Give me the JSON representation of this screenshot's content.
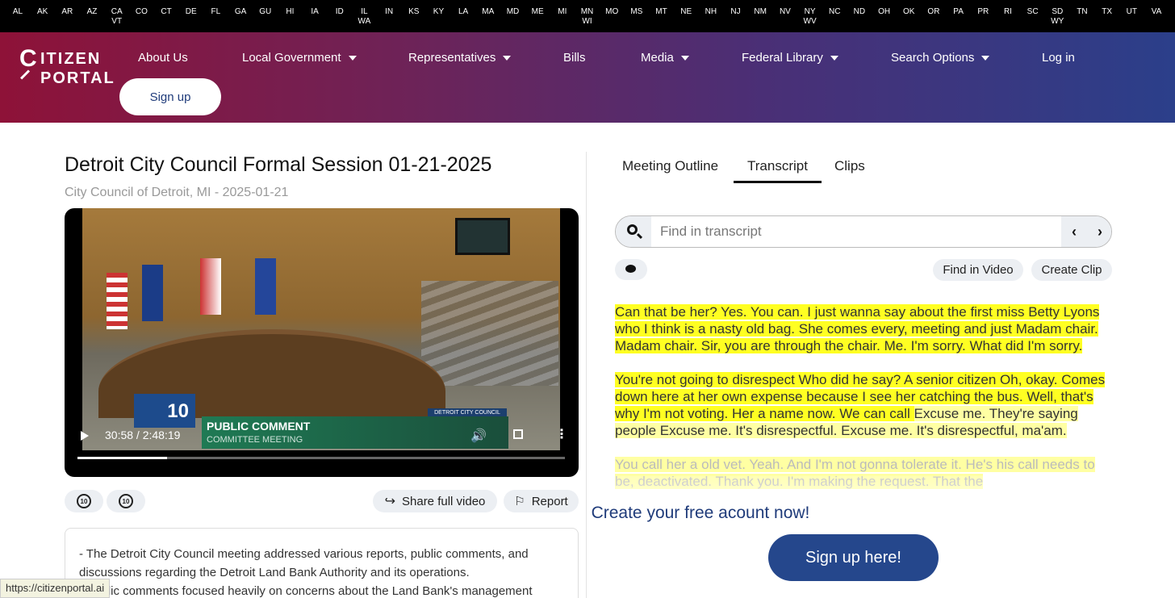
{
  "states": [
    {
      "a": "AL"
    },
    {
      "a": "AK"
    },
    {
      "a": "AR"
    },
    {
      "a": "AZ"
    },
    {
      "a": "CA",
      "b": "VT"
    },
    {
      "a": "CO"
    },
    {
      "a": "CT"
    },
    {
      "a": "DE"
    },
    {
      "a": "FL"
    },
    {
      "a": "GA"
    },
    {
      "a": "GU"
    },
    {
      "a": "HI"
    },
    {
      "a": "IA"
    },
    {
      "a": "ID"
    },
    {
      "a": "IL",
      "b": "WA"
    },
    {
      "a": "IN"
    },
    {
      "a": "KS"
    },
    {
      "a": "KY"
    },
    {
      "a": "LA"
    },
    {
      "a": "MA"
    },
    {
      "a": "MD"
    },
    {
      "a": "ME"
    },
    {
      "a": "MI"
    },
    {
      "a": "MN",
      "b": "WI"
    },
    {
      "a": "MO"
    },
    {
      "a": "MS"
    },
    {
      "a": "MT"
    },
    {
      "a": "NE"
    },
    {
      "a": "NH"
    },
    {
      "a": "NJ"
    },
    {
      "a": "NM"
    },
    {
      "a": "NV"
    },
    {
      "a": "NY",
      "b": "WV"
    },
    {
      "a": "NC"
    },
    {
      "a": "ND"
    },
    {
      "a": "OH"
    },
    {
      "a": "OK"
    },
    {
      "a": "OR"
    },
    {
      "a": "PA"
    },
    {
      "a": "PR"
    },
    {
      "a": "RI"
    },
    {
      "a": "SC"
    },
    {
      "a": "SD",
      "b": "WY"
    },
    {
      "a": "TN"
    },
    {
      "a": "TX"
    },
    {
      "a": "UT"
    },
    {
      "a": "VA"
    }
  ],
  "logo": {
    "letter": "C",
    "word1": "ITIZEN",
    "word2": "PORTAL"
  },
  "nav": {
    "about": "About Us",
    "local_government": "Local Government",
    "representatives": "Representatives",
    "bills": "Bills",
    "media": "Media",
    "federal_library": "Federal Library",
    "search_options": "Search Options",
    "login": "Log in",
    "signup": "Sign up"
  },
  "meeting": {
    "title": "Detroit City Council Formal Session 01-21-2025",
    "subtitle": "City Council of Detroit, MI - 2025-01-21"
  },
  "video": {
    "channel_number": "10",
    "lower_third_title": "PUBLIC COMMENT",
    "lower_third_sub": "COMMITTEE MEETING",
    "corner_tag": "DETROIT CITY COUNCIL",
    "time": "30:58 / 2:48:19",
    "progress_fraction": 0.1834,
    "icons": {
      "play": "play-icon",
      "volume": "volume-icon",
      "fullscreen": "fullscreen-icon",
      "more": "more-vertical-icon"
    }
  },
  "below_video": {
    "rewind_label": "10",
    "forward_label": "10",
    "share": "Share full video",
    "report": "Report"
  },
  "summary": {
    "line1": "- The Detroit City Council meeting addressed various reports, public comments, and discussions regarding the Detroit Land Bank Authority and its operations.",
    "line2": "- Public comments focused heavily on concerns about the Land Bank's management"
  },
  "status_url": "https://citizenportal.ai",
  "tabs": {
    "outline": "Meeting Outline",
    "transcript": "Transcript",
    "clips": "Clips"
  },
  "search": {
    "placeholder": "Find in transcript",
    "prev": "‹",
    "next": "›"
  },
  "actions": {
    "find_in_video": "Find in Video",
    "create_clip": "Create Clip"
  },
  "transcript": {
    "p1": "Can that be her? Yes. You can. I just wanna say about the first miss Betty Lyons who I think is a nasty old bag. She comes every, meeting and just Madam chair. Madam chair. Sir, you are through the chair. Me. I'm sorry. What did I'm sorry.",
    "p2a": "You're not going to disrespect Who did he say? A senior citizen Oh, okay. Comes down here at her own expense because I see her catching the bus. Well, that's why I'm not voting. Her a name now. We can call ",
    "p2b": "Excuse me. They're saying people Excuse me. It's disrespectful. Excuse me. It's disrespectful, ma'am.",
    "p3": "You call her a old vet. Yeah. And I'm not gonna tolerate it. He's his call needs to be, deactivated. Thank you. I'm making the request. That the"
  },
  "cta": {
    "text": "Create your free acount now!",
    "button": "Sign up here!"
  }
}
